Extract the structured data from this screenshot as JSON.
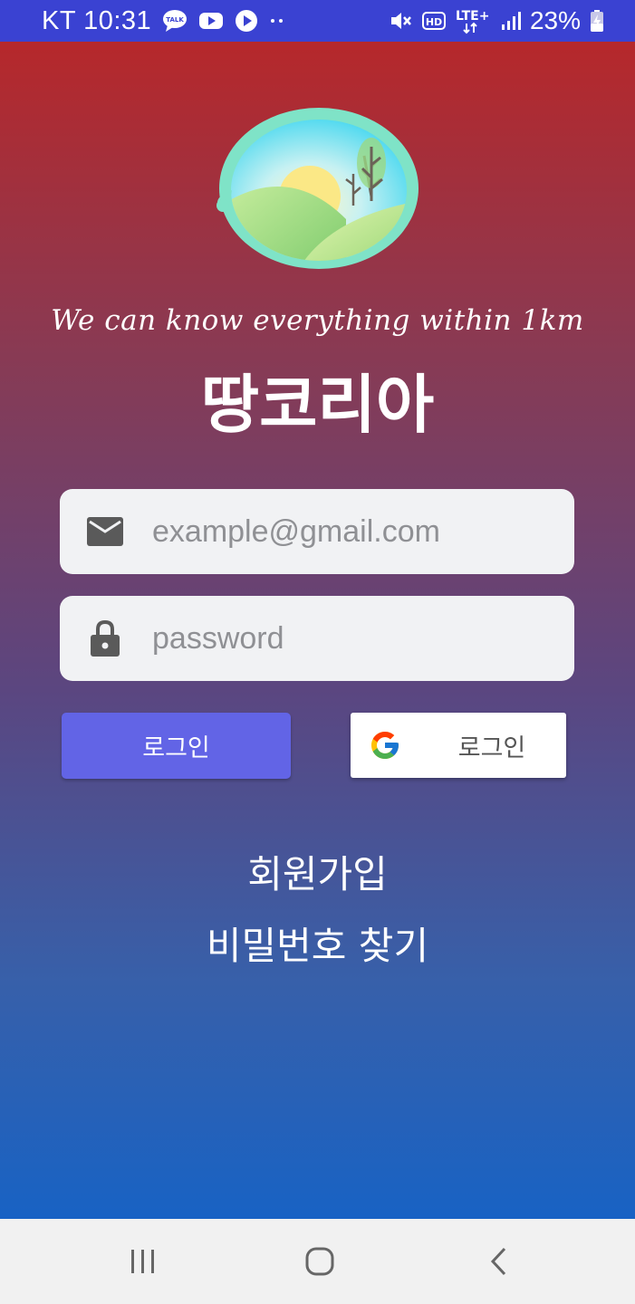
{
  "status_bar": {
    "carrier": "KT",
    "time": "10:31",
    "battery": "23%",
    "icons": [
      "talk-icon",
      "youtube-icon",
      "play-icon",
      "more-dots-icon",
      "mute-icon",
      "hd-icon",
      "lte-icon",
      "signal-icon",
      "battery-charging-icon"
    ],
    "hd_label": "HD",
    "lte_label": "LTE+"
  },
  "colors": {
    "status_bar": "#3a42d2",
    "gradient_top": "#b6282b",
    "gradient_bottom": "#1862c4",
    "login_button": "#6264e6"
  },
  "header": {
    "tagline": "We can know everything within 1km",
    "app_name": "땅코리아"
  },
  "form": {
    "email_placeholder": "example@gmail.com",
    "password_placeholder": "password"
  },
  "buttons": {
    "login_label": "로그인",
    "google_login_label": "로그인"
  },
  "links": {
    "signup": "회원가입",
    "find_password": "비밀번호 찾기"
  },
  "nav": {
    "icons": [
      "recent-apps-icon",
      "home-icon",
      "back-icon"
    ]
  }
}
